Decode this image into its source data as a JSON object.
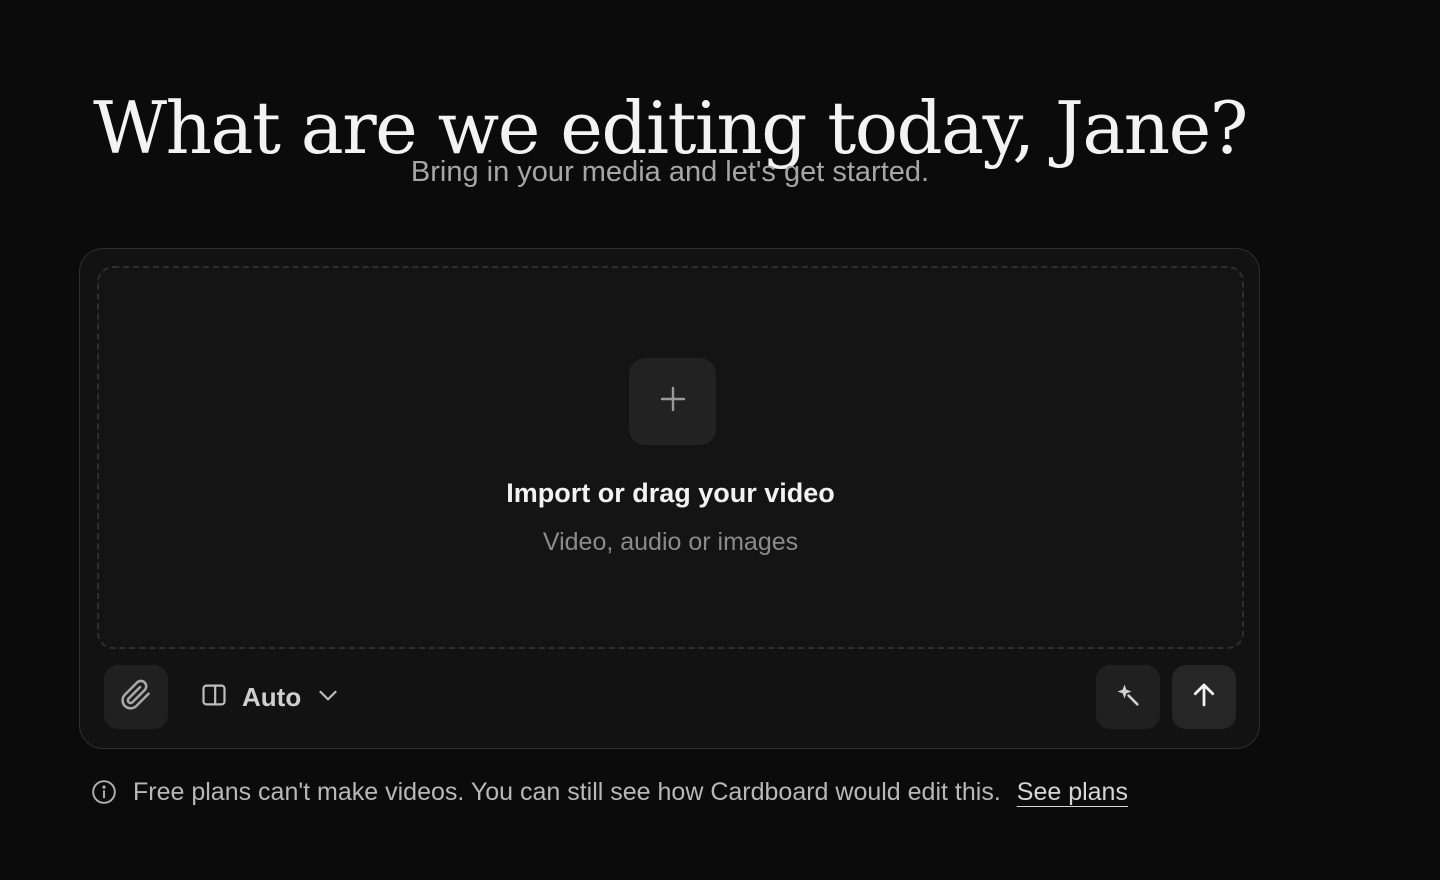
{
  "header": {
    "title": "What are we editing today, Jane?",
    "subtitle": "Bring in your media and let's get started."
  },
  "dropzone": {
    "add_icon": "plus-icon",
    "title": "Import or drag your video",
    "subtitle": "Video, audio or images"
  },
  "toolbar": {
    "attach_icon": "paperclip-icon",
    "mode_icon": "sidebar-layout-icon",
    "mode_label": "Auto",
    "mode_dropdown_icon": "chevron-down-icon",
    "magic_icon": "magic-wand-icon",
    "send_icon": "arrow-up-icon"
  },
  "notice": {
    "icon": "info-icon",
    "text": "Free plans can't make videos. You can still see how Cardboard would edit this.",
    "link": "See plans"
  },
  "colors": {
    "background": "#0b0b0b",
    "panel": "#121212",
    "button": "#202020"
  }
}
